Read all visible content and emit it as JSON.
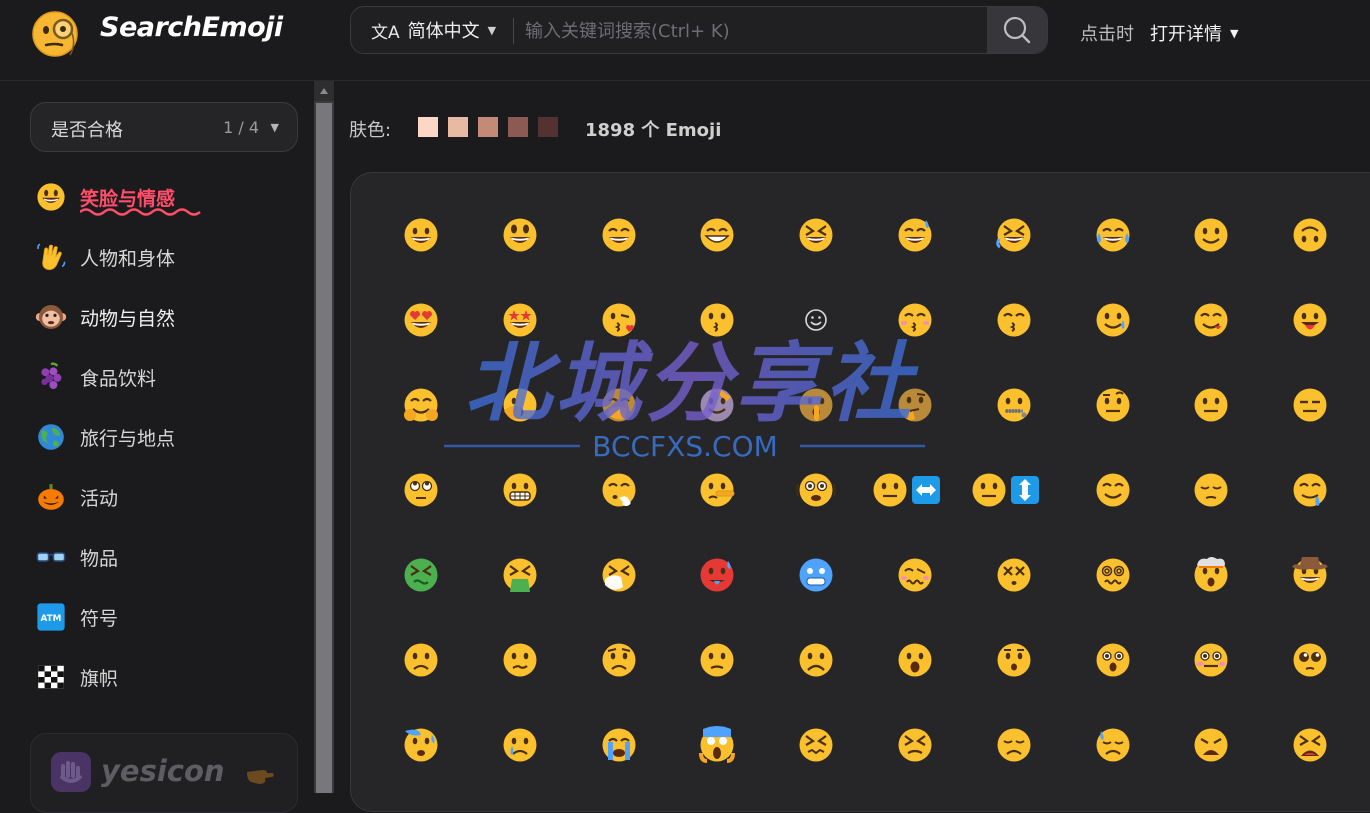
{
  "header": {
    "brand": "SearchEmoji",
    "language": "简体中文",
    "search_placeholder": "输入关键词搜索(Ctrl+ K)",
    "click_label": "点击时",
    "click_value": "打开详情"
  },
  "sidebar": {
    "filter_label": "是否合格",
    "filter_count": "1 / 4",
    "categories": [
      {
        "label": "笑脸与情感",
        "icon": "grinning-face-icon",
        "active": true
      },
      {
        "label": "人物和身体",
        "icon": "waving-hand-icon"
      },
      {
        "label": "动物与自然",
        "icon": "monkey-face-icon"
      },
      {
        "label": "食品饮料",
        "icon": "grapes-icon"
      },
      {
        "label": "旅行与地点",
        "icon": "globe-icon"
      },
      {
        "label": "活动",
        "icon": "jack-o-lantern-icon"
      },
      {
        "label": "物品",
        "icon": "glasses-icon"
      },
      {
        "label": "符号",
        "icon": "atm-sign-icon"
      },
      {
        "label": "旗帜",
        "icon": "checkered-flag-icon"
      }
    ],
    "promo_text": "yesicon"
  },
  "main": {
    "skin_label": "肤色:",
    "skin_tones": [
      "#fcd7c6",
      "#e8b9a3",
      "#c48a77",
      "#8c5a52",
      "#553232"
    ],
    "count_text": "1898 个 Emoji"
  },
  "emoji_grid": [
    [
      "grinning",
      "grinning-big-eyes",
      "grinning-smiling-eyes",
      "beaming",
      "squinting",
      "sweat-smile",
      "rolling-laughing",
      "tears-of-joy",
      "slightly-smiling",
      "upside-down"
    ],
    [
      "heart-eyes",
      "star-struck",
      "blowing-kiss",
      "kissing",
      "smiling-face",
      "kissing-closed-eyes",
      "kissing-smiling-eyes",
      "smiling-tear",
      "yum",
      "tongue"
    ],
    [
      "hugging",
      "peeking",
      "hand-over-mouth",
      "saluting",
      "shushing",
      "thinking",
      "zipper-mouth",
      "raised-eyebrow",
      "neutral",
      "expressionless"
    ],
    [
      "eye-roll",
      "grimacing",
      "face-exhaling",
      "lying",
      "shaking",
      "head-shaking-horizontally",
      "head-shaking-vertically",
      "relieved",
      "pensive",
      "drooling"
    ],
    [
      "nauseated",
      "vomiting",
      "sneezing",
      "hot",
      "cold",
      "woozy",
      "knocked-out",
      "spiral-eyes",
      "exploding-head",
      "cowboy"
    ],
    [
      "frowning",
      "confused",
      "worried",
      "slightly-frowning",
      "frowning-face",
      "open-mouth",
      "hushed",
      "astonished",
      "flushed",
      "pleading"
    ],
    [
      "anxious-sweat",
      "crying",
      "loudly-crying",
      "screaming",
      "confounded",
      "persevering",
      "disappointed",
      "downcast-sweat",
      "weary",
      "tired"
    ]
  ],
  "colors": {
    "accent": "#ff4d6a",
    "background": "#1b1b1d",
    "panel": "#262629",
    "emoji_yellow": "#fbc02d"
  },
  "watermark": {
    "title": "北城分享社",
    "subtitle": "BCCFXS.COM"
  }
}
